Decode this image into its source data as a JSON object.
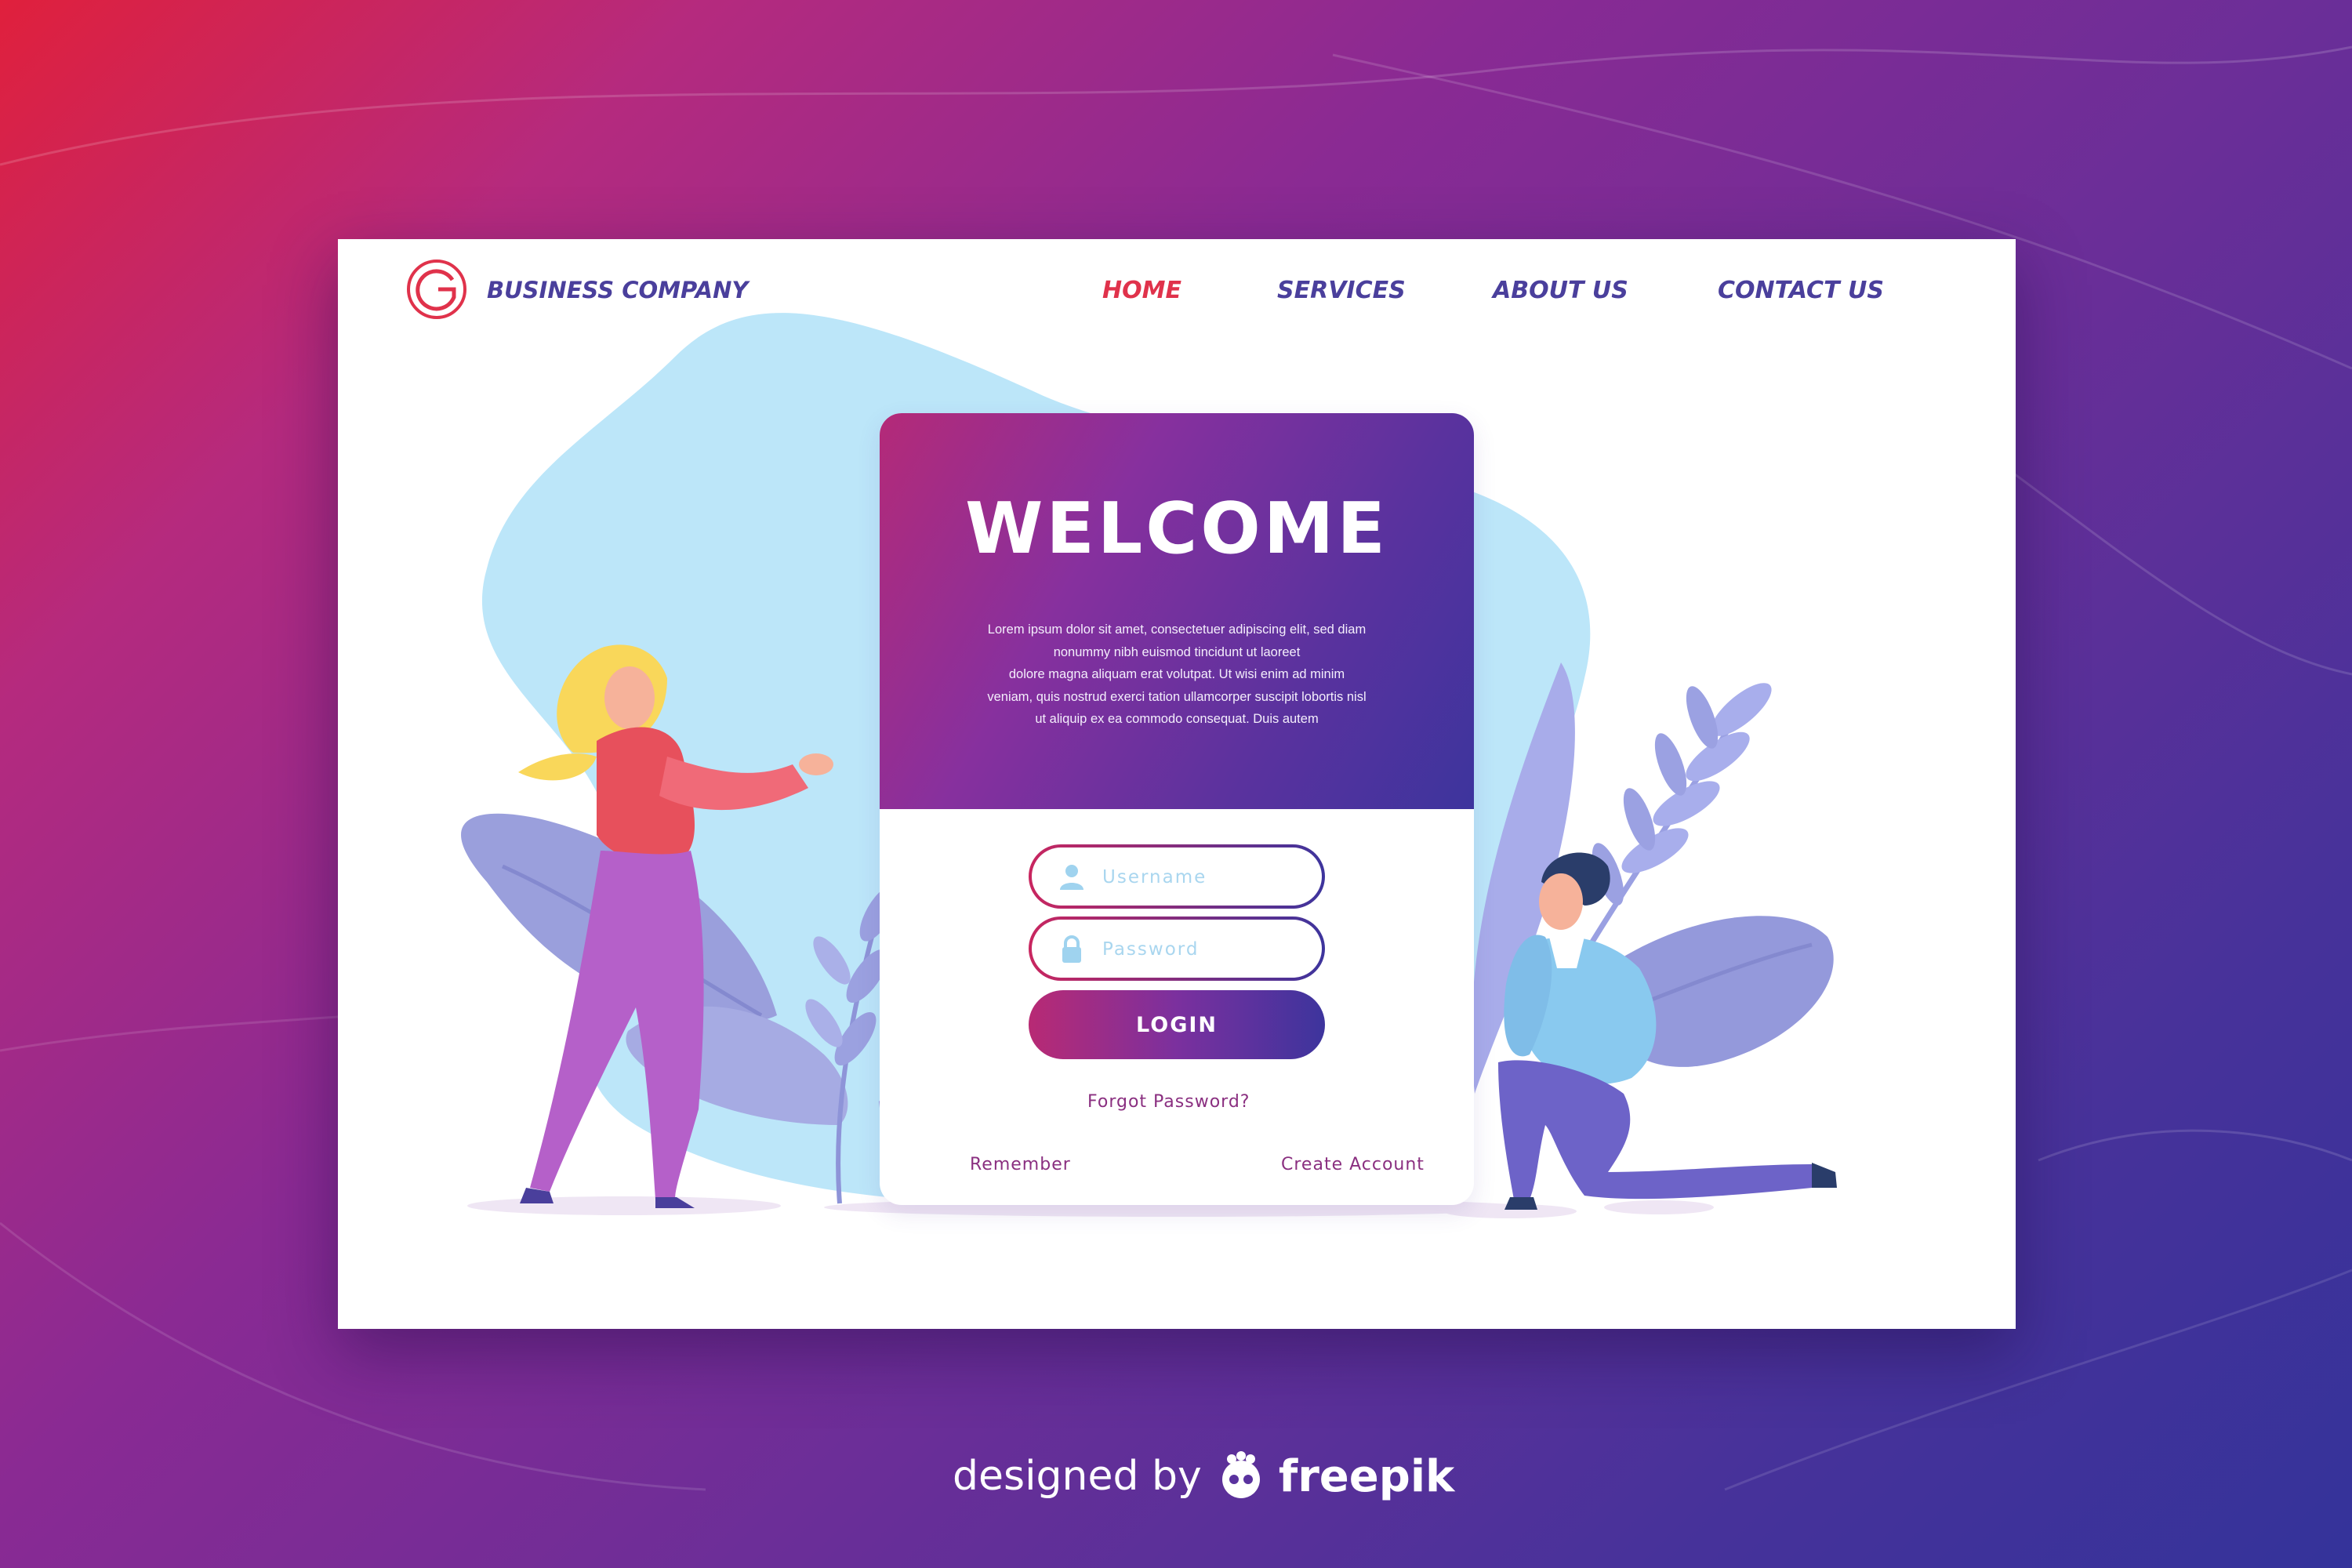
{
  "colors": {
    "brand_text": "#4a3f9c",
    "nav_active": "#e0324b",
    "gradient_start": "#b82a74",
    "gradient_end": "#3d349d",
    "link": "#8a2f80",
    "placeholder": "#a9d6ef"
  },
  "header": {
    "brand": "BUSINESS COMPANY",
    "logo_icon": "circle-g-logo-icon",
    "nav": [
      {
        "label": "HOME",
        "active": true
      },
      {
        "label": "SERVICES",
        "active": false
      },
      {
        "label": "ABOUT US",
        "active": false
      },
      {
        "label": "CONTACT US",
        "active": false
      }
    ]
  },
  "card": {
    "title": "WELCOME",
    "lorem_lines": [
      "Lorem ipsum dolor sit amet, consectetuer adipiscing elit, sed diam",
      "nonummy nibh euismod tincidunt ut laoreet",
      "dolore magna aliquam erat volutpat. Ut wisi enim ad minim",
      "veniam, quis nostrud exerci tation ullamcorper suscipit lobortis nisl",
      "ut aliquip ex ea commodo consequat. Duis autem"
    ],
    "username_placeholder": "Username",
    "username_icon": "user-icon",
    "password_placeholder": "Password",
    "password_icon": "lock-icon",
    "login_label": "LOGIN",
    "forgot_label": "Forgot Password?",
    "remember_label": "Remember",
    "create_label": "Create Account"
  },
  "footer": {
    "designed_by": "designed by",
    "brand": "freepik",
    "brand_icon": "freepik-mascot-icon"
  }
}
